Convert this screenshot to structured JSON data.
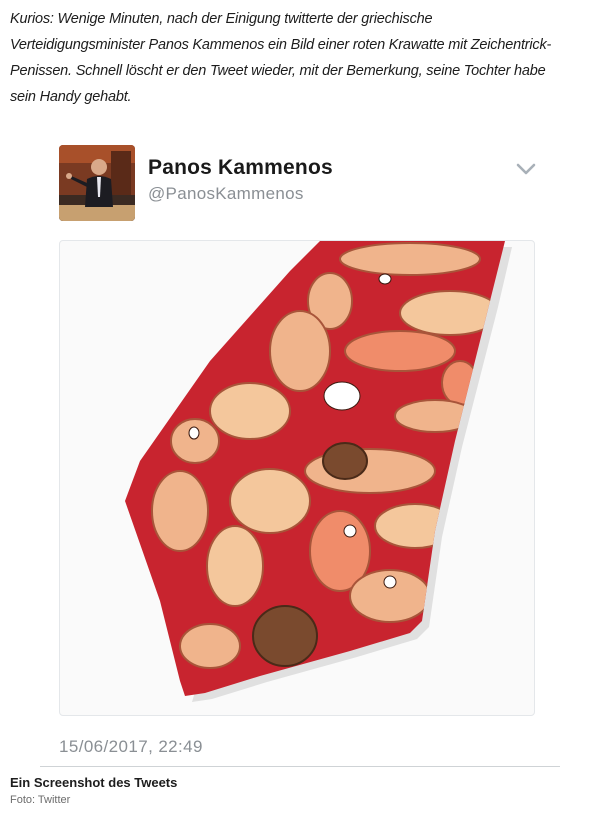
{
  "article": {
    "intro_text": "Kurios: Wenige Minuten, nach der Einigung twitterte der griechische Verteidigungsminister Panos Kammenos ein Bild einer roten Krawatte mit Zeichentrick-Penissen. Schnell löscht er den Tweet wieder, mit der Bemerkung, seine Tochter habe sein Handy gehabt."
  },
  "tweet": {
    "display_name": "Panos Kammenos",
    "handle": "@PanosKammenos",
    "timestamp": "15/06/2017, 22:49",
    "menu_icon": "chevron-down-icon",
    "media_description_icon": "tie-image"
  },
  "caption": {
    "title": "Ein Screenshot des Tweets",
    "credit": "Foto: Twitter"
  },
  "colors": {
    "tie_red": "#c8242f",
    "pattern_skin": "#f0b48c",
    "pattern_brown": "#7a4a2e",
    "handle_gray": "#8a8f94"
  }
}
